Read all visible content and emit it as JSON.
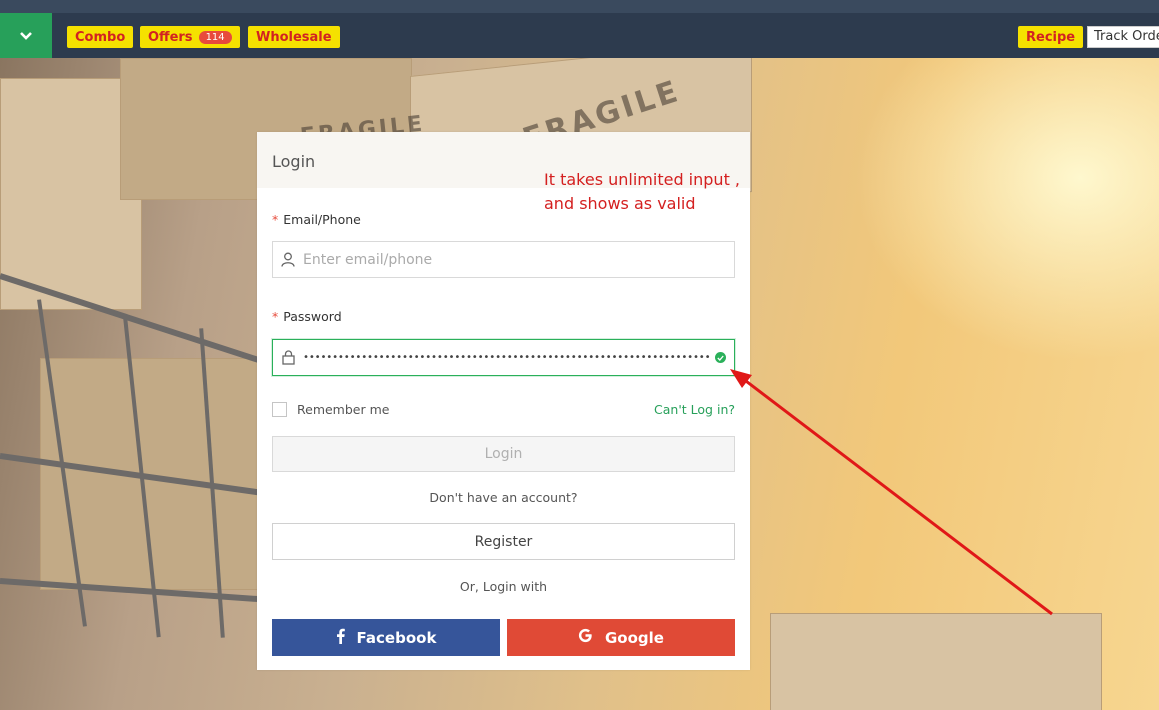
{
  "navbar": {
    "tags": [
      {
        "label": "Combo"
      },
      {
        "label": "Offers",
        "badge": "114"
      },
      {
        "label": "Wholesale"
      }
    ],
    "recipe_label": "Recipe",
    "track_order_label": "Track Order"
  },
  "background": {
    "fragile_text": "FRAGILE"
  },
  "login_card": {
    "title": "Login",
    "email_label": "Email/Phone",
    "email_placeholder": "Enter email/phone",
    "email_value": "",
    "password_label": "Password",
    "password_value": "••••••••••••••••••••••••••••••••••••••••••••••••••••••••••••••••••••••••••••••••••••••••••••",
    "password_valid": true,
    "remember_label": "Remember me",
    "remember_checked": false,
    "cant_login_label": "Can't Log in?",
    "login_button": "Login",
    "no_account_text": "Don't have an account?",
    "register_button": "Register",
    "or_login_with": "Or, Login with",
    "facebook_button": "Facebook",
    "google_button": "Google"
  },
  "annotation": {
    "text": "It takes unlimited input ,\nand shows as valid",
    "color": "#d42020"
  },
  "colors": {
    "nav_bg": "#2d3b4e",
    "accent_green": "#27a05a",
    "tag_yellow": "#f5e100",
    "tag_text_red": "#d22222",
    "facebook": "#36559a",
    "google": "#e04a36"
  }
}
